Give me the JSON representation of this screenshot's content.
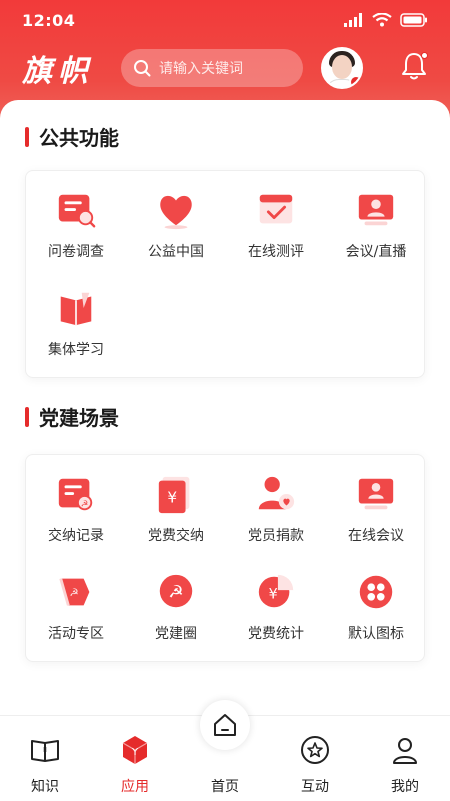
{
  "status_bar": {
    "time": "12:04"
  },
  "header": {
    "logo_text": "旗帜",
    "search_placeholder": "请输入关键词"
  },
  "sections": [
    {
      "title": "公共功能",
      "items": [
        {
          "label": "问卷调查",
          "icon": "survey-icon"
        },
        {
          "label": "公益中国",
          "icon": "heart-icon"
        },
        {
          "label": "在线测评",
          "icon": "assessment-icon"
        },
        {
          "label": "会议/直播",
          "icon": "meeting-live-icon"
        },
        {
          "label": "集体学习",
          "icon": "book-icon"
        }
      ]
    },
    {
      "title": "党建场景",
      "items": [
        {
          "label": "交纳记录",
          "icon": "payment-record-icon"
        },
        {
          "label": "党费交纳",
          "icon": "fee-payment-icon"
        },
        {
          "label": "党员捐款",
          "icon": "donation-icon"
        },
        {
          "label": "在线会议",
          "icon": "online-meeting-icon"
        },
        {
          "label": "活动专区",
          "icon": "flag-icon"
        },
        {
          "label": "党建圈",
          "icon": "party-circle-icon"
        },
        {
          "label": "党费统计",
          "icon": "statistics-icon"
        },
        {
          "label": "默认图标",
          "icon": "default-grid-icon"
        }
      ]
    }
  ],
  "tabbar": {
    "items": [
      {
        "label": "知识",
        "icon": "book-open-icon"
      },
      {
        "label": "应用",
        "icon": "app-cube-icon",
        "active": true
      },
      {
        "label": "首页",
        "icon": "home-icon"
      },
      {
        "label": "互动",
        "icon": "star-circle-icon"
      },
      {
        "label": "我的",
        "icon": "user-icon"
      }
    ]
  },
  "colors": {
    "brand_red": "#e52b2b",
    "text_dark": "#222222"
  }
}
